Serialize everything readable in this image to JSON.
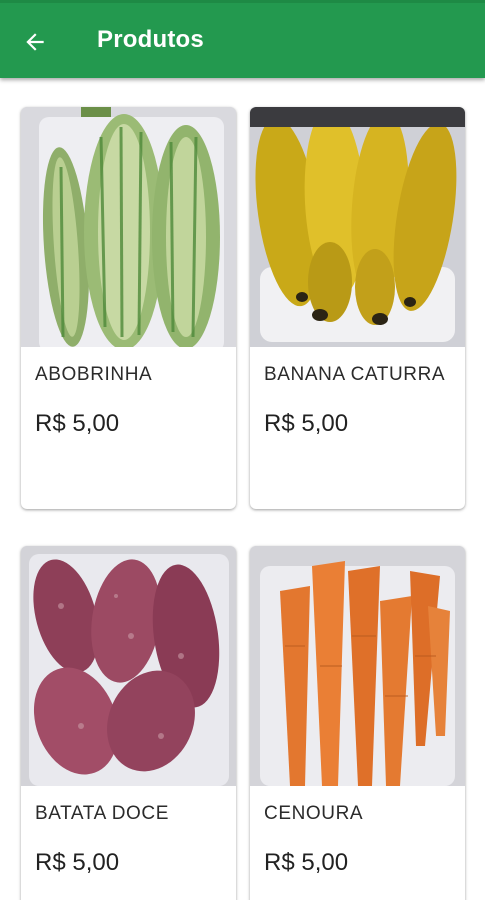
{
  "appbar": {
    "title": "Produtos",
    "back_icon": "arrow-left-icon",
    "color": "#23994f"
  },
  "products": [
    {
      "name": "ABOBRINHA",
      "price": "R$ 5,00",
      "image": "zucchini-photo"
    },
    {
      "name": "BANANA CATURRA",
      "price": "R$ 5,00",
      "image": "banana-photo"
    },
    {
      "name": "BATATA DOCE",
      "price": "R$ 5,00",
      "image": "sweet-potato-photo"
    },
    {
      "name": "CENOURA",
      "price": "R$ 5,00",
      "image": "carrot-photo"
    }
  ]
}
